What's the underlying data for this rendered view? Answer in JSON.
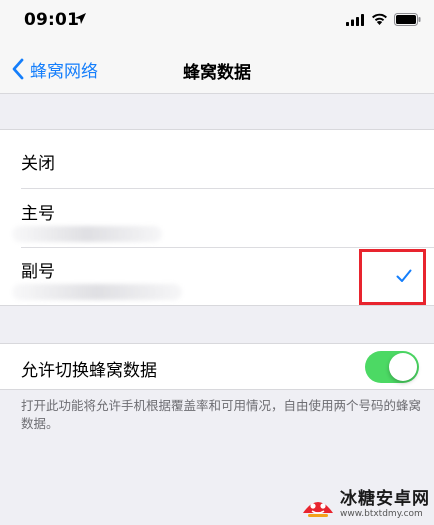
{
  "status_bar": {
    "time": "09:01",
    "icons": [
      "location-arrow-icon",
      "cellular-signal-icon",
      "wifi-icon",
      "battery-icon"
    ]
  },
  "nav": {
    "back_label": "蜂窝网络",
    "title": "蜂窝数据"
  },
  "sim_options": {
    "items": [
      {
        "label": "关闭",
        "selected": false
      },
      {
        "label": "主号",
        "selected": false
      },
      {
        "label": "副号",
        "selected": true
      }
    ]
  },
  "switching": {
    "label": "允许切换蜂窝数据",
    "enabled": true,
    "footnote": "打开此功能将允许手机根据覆盖率和可用情况，自由使用两个号码的蜂窝数据。"
  },
  "colors": {
    "accent": "#147efb",
    "toggle_on": "#4cd964",
    "highlight_box": "#e8242e"
  },
  "watermark": {
    "title": "冰糖安卓网",
    "url": "www.btxtdmy.com"
  }
}
